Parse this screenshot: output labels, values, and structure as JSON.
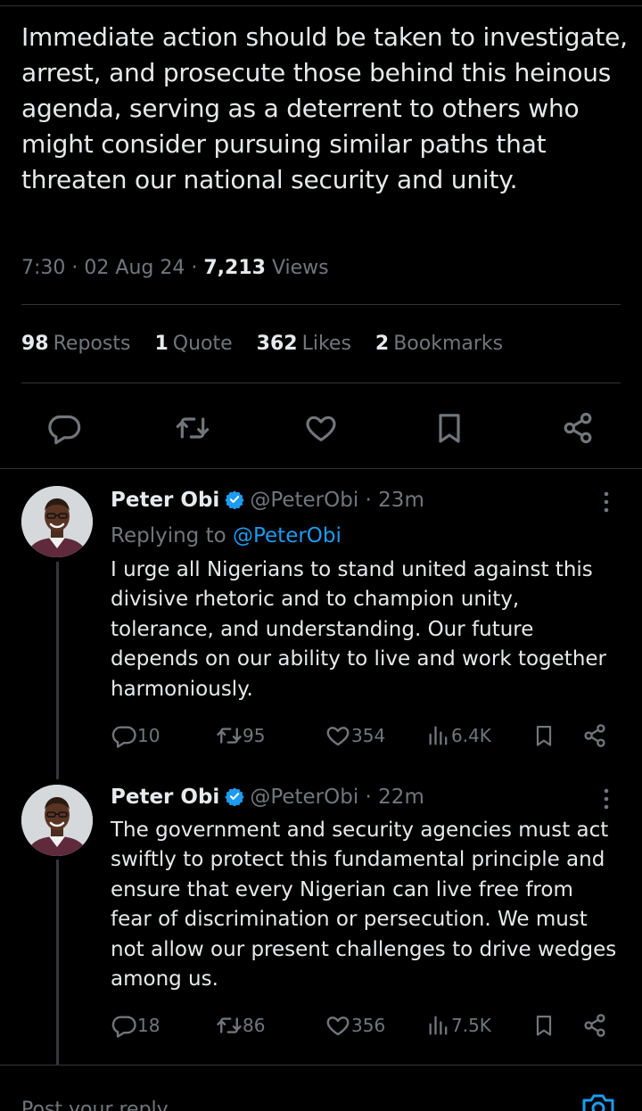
{
  "tweet": {
    "text": "Immediate action should be taken to investigate, arrest, and prosecute those behind this heinous agenda, serving as a deterrent to others who might consider pursuing similar paths that threaten our national security and unity.",
    "time": "7:30",
    "date": "02 Aug 24",
    "separator": "·",
    "views_count": "7,213",
    "views_label": "Views"
  },
  "stats": [
    {
      "count": "98",
      "label": "Reposts"
    },
    {
      "count": "1",
      "label": "Quote"
    },
    {
      "count": "362",
      "label": "Likes"
    },
    {
      "count": "2",
      "label": "Bookmarks"
    }
  ],
  "actions": [
    "reply-icon",
    "repost-icon",
    "like-icon",
    "bookmark-icon",
    "share-icon"
  ],
  "replies": [
    {
      "name": "Peter Obi",
      "handle": "@PeterObi",
      "time_sep": "·",
      "time": "23m",
      "replying_prefix": "Replying to",
      "replying_to": "@PeterObi",
      "text": "I urge all Nigerians to stand united against this divisive rhetoric and to champion unity, tolerance, and understanding. Our future depends on our ability to live and work together harmoniously.",
      "replies": "10",
      "reposts": "95",
      "likes": "354",
      "views": "6.4K"
    },
    {
      "name": "Peter Obi",
      "handle": "@PeterObi",
      "time_sep": "·",
      "time": "22m",
      "text": "The government and security agencies must act swiftly to protect this fundamental principle and ensure that every Nigerian can live free from fear of discrimination or persecution. We must not allow our present challenges to drive wedges among us.",
      "replies": "18",
      "reposts": "86",
      "likes": "356",
      "views": "7.5K"
    }
  ],
  "compose": {
    "placeholder": "Post your reply"
  },
  "colors": {
    "background": "#000000",
    "text": "#e7e9ea",
    "muted": "#71767b",
    "accent": "#1d9bf0",
    "divider": "#2f3336"
  }
}
